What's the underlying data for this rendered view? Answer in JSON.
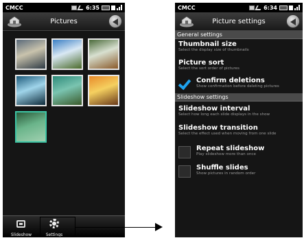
{
  "left_screen": {
    "status": {
      "carrier": "CMCC",
      "time": "6:35"
    },
    "title": "Pictures",
    "bottom_tabs": [
      {
        "label": "Slideshow",
        "icon": "slideshow-icon"
      },
      {
        "label": "Settings",
        "icon": "gear-icon"
      }
    ],
    "thumbnails": [
      {
        "name": "photo-1",
        "colors": [
          "#5a6a7a",
          "#c9c3ad",
          "#2e3a45"
        ]
      },
      {
        "name": "photo-2",
        "colors": [
          "#3b7fc4",
          "#d9e8f4",
          "#4a6a2a"
        ]
      },
      {
        "name": "photo-3",
        "colors": [
          "#4a6a3a",
          "#d8e0d0",
          "#8a5a2a"
        ]
      },
      {
        "name": "photo-4",
        "colors": [
          "#1e5a7a",
          "#9fd4ea",
          "#0d2a3a"
        ]
      },
      {
        "name": "photo-5",
        "colors": [
          "#2e8a7a",
          "#7ac4b0",
          "#3a5a2a"
        ]
      },
      {
        "name": "photo-6",
        "colors": [
          "#e88a2a",
          "#f5d060",
          "#6a3a1a"
        ]
      },
      {
        "name": "photo-7",
        "colors": [
          "#2a5a3a",
          "#6ab48a",
          "#a0d0b0"
        ]
      }
    ]
  },
  "right_screen": {
    "status": {
      "carrier": "CMCC",
      "time": "6:34"
    },
    "title": "Picture settings",
    "general_header": "General settings",
    "slideshow_header": "Slideshow settings",
    "general_items": [
      {
        "title": "Thumbnail size",
        "desc": "Select the display size of thumbnails"
      },
      {
        "title": "Picture sort",
        "desc": "Select the sort order of pictures"
      }
    ],
    "confirm": {
      "title": "Confirm deletions",
      "desc": "Show confirmation before deleting pictures",
      "checked": true
    },
    "slideshow_items": [
      {
        "title": "Slideshow interval",
        "desc": "Select how long each slide displays in the show"
      },
      {
        "title": "Slideshow transition",
        "desc": "Select the effect used when moving from one slide"
      }
    ],
    "checkbox_items": [
      {
        "title": "Repeat slideshow",
        "desc": "Play slideshow more than once",
        "checked": false
      },
      {
        "title": "Shuffle slides",
        "desc": "Show pictures in random order",
        "checked": false
      }
    ],
    "accent_color": "#1ea3f0"
  }
}
